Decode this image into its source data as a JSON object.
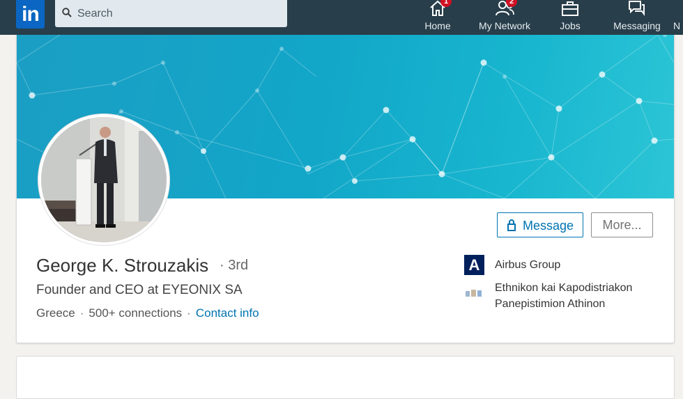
{
  "nav": {
    "logo": "in",
    "search_placeholder": "Search",
    "items": [
      {
        "label": "Home",
        "icon": "home-icon",
        "badge": "1"
      },
      {
        "label": "My Network",
        "icon": "network-icon",
        "badge": "2"
      },
      {
        "label": "Jobs",
        "icon": "briefcase-icon"
      },
      {
        "label": "Messaging",
        "icon": "messaging-icon"
      },
      {
        "label": "N"
      }
    ]
  },
  "profile": {
    "name": "George K. Strouzakis",
    "degree": "· 3rd",
    "headline": "Founder and CEO at EYEONIX SA",
    "location": "Greece",
    "connections": "500+ connections",
    "contact_info": "Contact info",
    "message_label": "Message",
    "more_label": "More...",
    "company_logo_letter": "A",
    "company": "Airbus Group",
    "school": "Ethnikon kai Kapodistriakon Panepistimion Athinon"
  },
  "colors": {
    "nav_bg": "#283e4a",
    "brand_blue": "#0073b1",
    "banner": "#12a6c8",
    "badge": "#d11124"
  }
}
